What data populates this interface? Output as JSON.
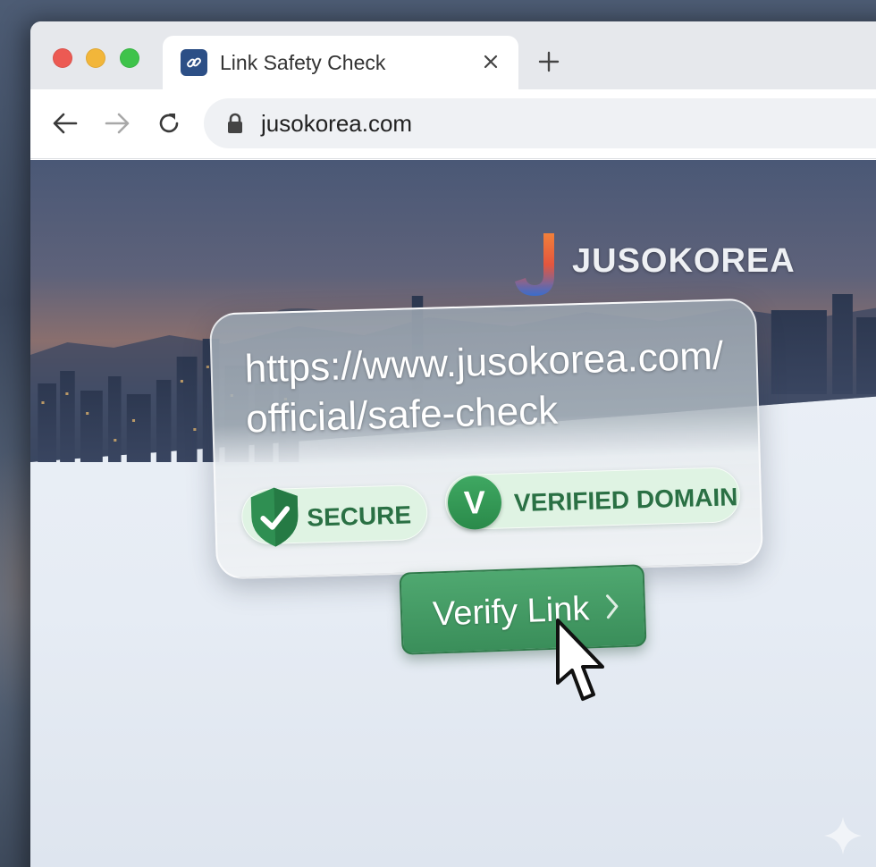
{
  "browser": {
    "tab": {
      "title": "Link Safety Check",
      "favicon_icon": "link-icon"
    },
    "toolbar": {
      "url": "jusokorea.com",
      "lock_icon": "lock-icon"
    }
  },
  "page": {
    "logo_text": "JUSOKOREA",
    "popover": {
      "url_line1": "https://www.jusokorea.com/",
      "url_line2": "official/safe-check",
      "badges": [
        {
          "label": "SECURE",
          "icon": "shield-check-icon",
          "color": "#2a7044"
        },
        {
          "label": "VERIFIED DOMAIN",
          "icon": "v-circle-icon",
          "icon_letter": "V",
          "color": "#2a7044"
        }
      ]
    },
    "verify_button": {
      "label": "Verify Link",
      "color": "#3a8e5a"
    }
  },
  "colors": {
    "accent": "#3a8e5a",
    "badge_bg": "#dff3e3",
    "favicon_bg": "#2c4f86"
  }
}
